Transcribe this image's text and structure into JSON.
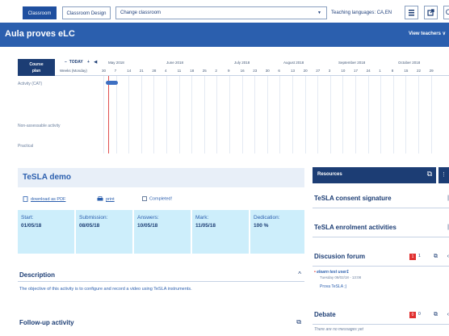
{
  "toolbar": {
    "tab_classroom": "Classroom",
    "tab_classroom_design": "Classroom Design",
    "change_classroom_placeholder": "Change classroom",
    "teaching_languages": "Teaching languages: CA,EN",
    "caret": "▼"
  },
  "header": {
    "title": "Aula proves eLC",
    "view_teachers": "View teachers"
  },
  "gantt": {
    "course_plan_line1": "Course",
    "course_plan_line2": "plan",
    "today": "TODAY",
    "weeks_label": "Weeks (Monday)",
    "months": [
      "May 2018",
      "June 2018",
      "July 2018",
      "August 2018",
      "September 2018",
      "October 2018"
    ],
    "days": [
      "30",
      "7",
      "14",
      "21",
      "28",
      "4",
      "11",
      "18",
      "25",
      "2",
      "9",
      "16",
      "23",
      "30",
      "6",
      "13",
      "20",
      "27",
      "3",
      "10",
      "17",
      "24",
      "1",
      "8",
      "15",
      "22",
      "29"
    ],
    "rows": [
      "Activity (CAT)",
      "Non-assessable activity",
      "Practical"
    ]
  },
  "activity": {
    "title": "TeSLA demo",
    "download_pdf": "download as PDF",
    "print": "print",
    "completed": "Completed!",
    "dates": [
      {
        "label": "Start:",
        "value": "01/05/18"
      },
      {
        "label": "Submission:",
        "value": "08/05/18"
      },
      {
        "label": "Answers:",
        "value": "10/05/18"
      },
      {
        "label": "Mark:",
        "value": "11/05/18"
      },
      {
        "label": "Dedication:",
        "value": "100 %"
      }
    ],
    "description_title": "Description",
    "description_text": "The objective of this activity is to configure and record a video using TeSLA instruments.",
    "followup_title": "Follow-up activity"
  },
  "right": {
    "resources": "Resources",
    "consent": "TeSLA consent signature",
    "enrolment": "TeSLA enrolment activities",
    "forum": "Discusion forum",
    "forum_badge": "1",
    "forum_count": "1",
    "forum_user": "elearn test user1",
    "forum_date": "Tuesday 08/02/18 - 13:08",
    "forum_msg": "Prova TeSLA ;)",
    "debate": "Debate",
    "debate_badge": "0",
    "debate_count": "0",
    "debate_empty": "There are no messages yet"
  },
  "colors": {
    "band": "#2b5fae",
    "dark": "#1c3d74",
    "date_bg": "#cdeefb",
    "badge": "#e03030"
  }
}
